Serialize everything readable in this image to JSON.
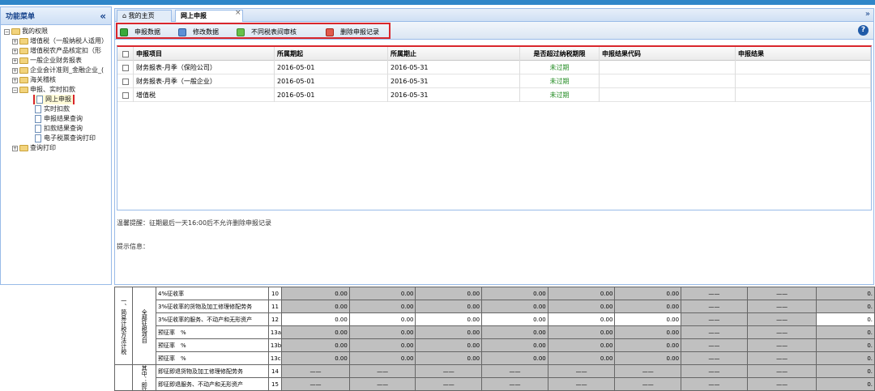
{
  "sidebar": {
    "title": "功能菜单",
    "collapse_icon": "double-left-arrow",
    "tree": [
      {
        "label": "我的权限",
        "level": 0,
        "toggle": "−"
      },
      {
        "label": "增值税（一般纳税人适用）",
        "level": 1,
        "toggle": "+"
      },
      {
        "label": "增值税农产品核定扣（形",
        "level": 1,
        "toggle": "+"
      },
      {
        "label": "一般企业财务报表",
        "level": 1,
        "toggle": "+"
      },
      {
        "label": "企业会计准则_金融企业_(",
        "level": 1,
        "toggle": "+"
      },
      {
        "label": "海关稽核",
        "level": 1,
        "toggle": "+"
      },
      {
        "label": "申报、实时扣款",
        "level": 1,
        "toggle": "−"
      },
      {
        "label": "网上申报",
        "level": 2
      },
      {
        "label": "实时扣款",
        "level": 2
      },
      {
        "label": "申报结果查询",
        "level": 2
      },
      {
        "label": "扣款结果查询",
        "level": 2
      },
      {
        "label": "电子税票查询打印",
        "level": 2
      },
      {
        "label": "查询打印",
        "level": 1,
        "toggle": "+"
      }
    ]
  },
  "tabs": {
    "home": "我的主页",
    "active": "网上申报",
    "close": "×",
    "menu": "»"
  },
  "toolbar": {
    "buttons": [
      "申报数据",
      "修改数据",
      "不同税表间审核",
      "删除申报记录"
    ],
    "help": "?"
  },
  "grid": {
    "columns": [
      "申报项目",
      "所属期起",
      "所属期止",
      "是否超过纳税期限",
      "申报结果代码",
      "申报结果"
    ],
    "rows": [
      {
        "item": "财务报表-月季（保险公司）",
        "start": "2016-05-01",
        "end": "2016-05-31",
        "overdue": "未过期",
        "code": "",
        "result": ""
      },
      {
        "item": "财务报表-月季（一般企业）",
        "start": "2016-05-01",
        "end": "2016-05-31",
        "overdue": "未过期",
        "code": "",
        "result": ""
      },
      {
        "item": "增值税",
        "start": "2016-05-01",
        "end": "2016-05-31",
        "overdue": "未过期",
        "code": "",
        "result": ""
      }
    ]
  },
  "tip": "温馨提醒：征期最后一天16:00后不允许删除申报记录",
  "info": "提示信息：",
  "lower_form": {
    "category": "一、简易计税方法计税",
    "sub_all": "全部征税项目",
    "sub_exempt": "其中：即征即退项目",
    "rows": [
      {
        "label": "4%征收率",
        "num": "10",
        "values": [
          "0.00",
          "0.00",
          "0.00",
          "0.00",
          "0.00",
          "0.00",
          "——",
          "——",
          "0."
        ],
        "white": false
      },
      {
        "label": "3%征收率的货物及加工修理修配劳务",
        "num": "11",
        "values": [
          "0.00",
          "0.00",
          "0.00",
          "0.00",
          "0.00",
          "0.00",
          "——",
          "——",
          "0."
        ],
        "white": false
      },
      {
        "label": "3%征收率的服务、不动产和无形资产",
        "num": "12",
        "values": [
          "0.00",
          "0.00",
          "0.00",
          "0.00",
          "0.00",
          "0.00",
          "——",
          "——",
          "0."
        ],
        "white": true
      },
      {
        "label": "预征率　%",
        "num": "13a",
        "values": [
          "0.00",
          "0.00",
          "0.00",
          "0.00",
          "0.00",
          "0.00",
          "——",
          "——",
          "0."
        ],
        "white": false
      },
      {
        "label": "预征率　%",
        "num": "13b",
        "values": [
          "0.00",
          "0.00",
          "0.00",
          "0.00",
          "0.00",
          "0.00",
          "——",
          "——",
          "0."
        ],
        "white": false
      },
      {
        "label": "预征率　%",
        "num": "13c",
        "values": [
          "0.00",
          "0.00",
          "0.00",
          "0.00",
          "0.00",
          "0.00",
          "——",
          "——",
          "0."
        ],
        "white": false
      },
      {
        "label": "即征即退货物及加工修理修配劳务",
        "num": "14",
        "values": [
          "——",
          "——",
          "——",
          "——",
          "——",
          "——",
          "——",
          "——",
          "0."
        ],
        "white": false
      },
      {
        "label": "即征即退服务、不动产和无形资产",
        "num": "15",
        "values": [
          "——",
          "——",
          "——",
          "——",
          "——",
          "——",
          "——",
          "——",
          "0."
        ],
        "white": false
      }
    ]
  }
}
